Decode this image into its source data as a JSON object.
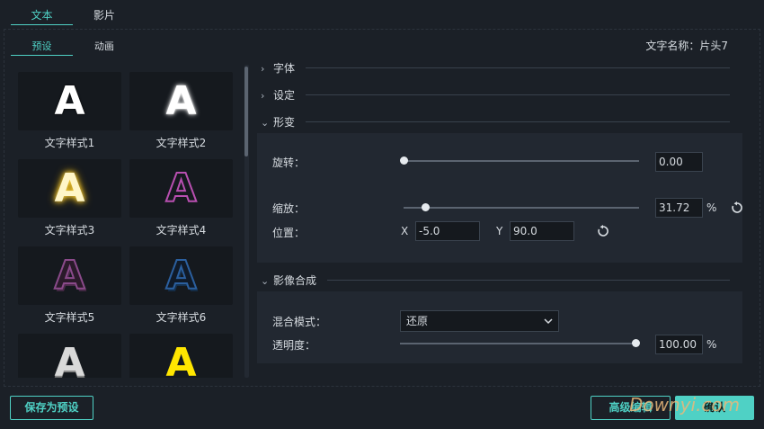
{
  "top_tabs": [
    {
      "label": "文本",
      "active": true
    },
    {
      "label": "影片",
      "active": false
    }
  ],
  "sub_tabs": [
    {
      "label": "预设",
      "active": true
    },
    {
      "label": "动画",
      "active": false
    }
  ],
  "presets": [
    {
      "letter": "A",
      "label": "文字样式1",
      "color": "#ffffff"
    },
    {
      "letter": "A",
      "label": "文字样式2",
      "color": "#ffffff"
    },
    {
      "letter": "A",
      "label": "文字样式3",
      "color": "#fff6c8"
    },
    {
      "letter": "A",
      "label": "文字样式4",
      "color": "#b84fb0"
    },
    {
      "letter": "A",
      "label": "文字样式5",
      "color": "#7a3c7a"
    },
    {
      "letter": "A",
      "label": "文字样式6",
      "color": "#2b5f9e"
    },
    {
      "letter": "A",
      "label": "",
      "color": "#d9d9d9"
    },
    {
      "letter": "A",
      "label": "",
      "color": "#ffe600"
    }
  ],
  "text_name": "文字名称：片头7",
  "sections": {
    "font": "字体",
    "settings": "设定",
    "transform": "形变",
    "compositing": "影像合成"
  },
  "transform": {
    "rotation_label": "旋转：",
    "rotation_value": "0.00",
    "rotation_fraction": 0.0,
    "scale_label": "缩放：",
    "scale_value": "31.72",
    "scale_unit": "%",
    "scale_fraction": 0.09,
    "position_label": "位置：",
    "x_label": "X",
    "x_value": "-5.0",
    "y_label": "Y",
    "y_value": "90.0"
  },
  "compositing": {
    "blend_label": "混合模式：",
    "blend_value": "还原",
    "opacity_label": "透明度：",
    "opacity_value": "100.00",
    "opacity_unit": "%",
    "opacity_fraction": 1.0
  },
  "buttons": {
    "save_preset": "保存为预设",
    "advanced": "高级编辑",
    "ok": "确认"
  },
  "watermark": "Downyi.com",
  "colors": {
    "accent": "#4fd1c5",
    "background": "#1b2027",
    "panel": "#222831"
  },
  "icons": {
    "chevron_right": "chevron-right-icon",
    "chevron_down": "chevron-down-icon",
    "reset": "reset-icon"
  }
}
